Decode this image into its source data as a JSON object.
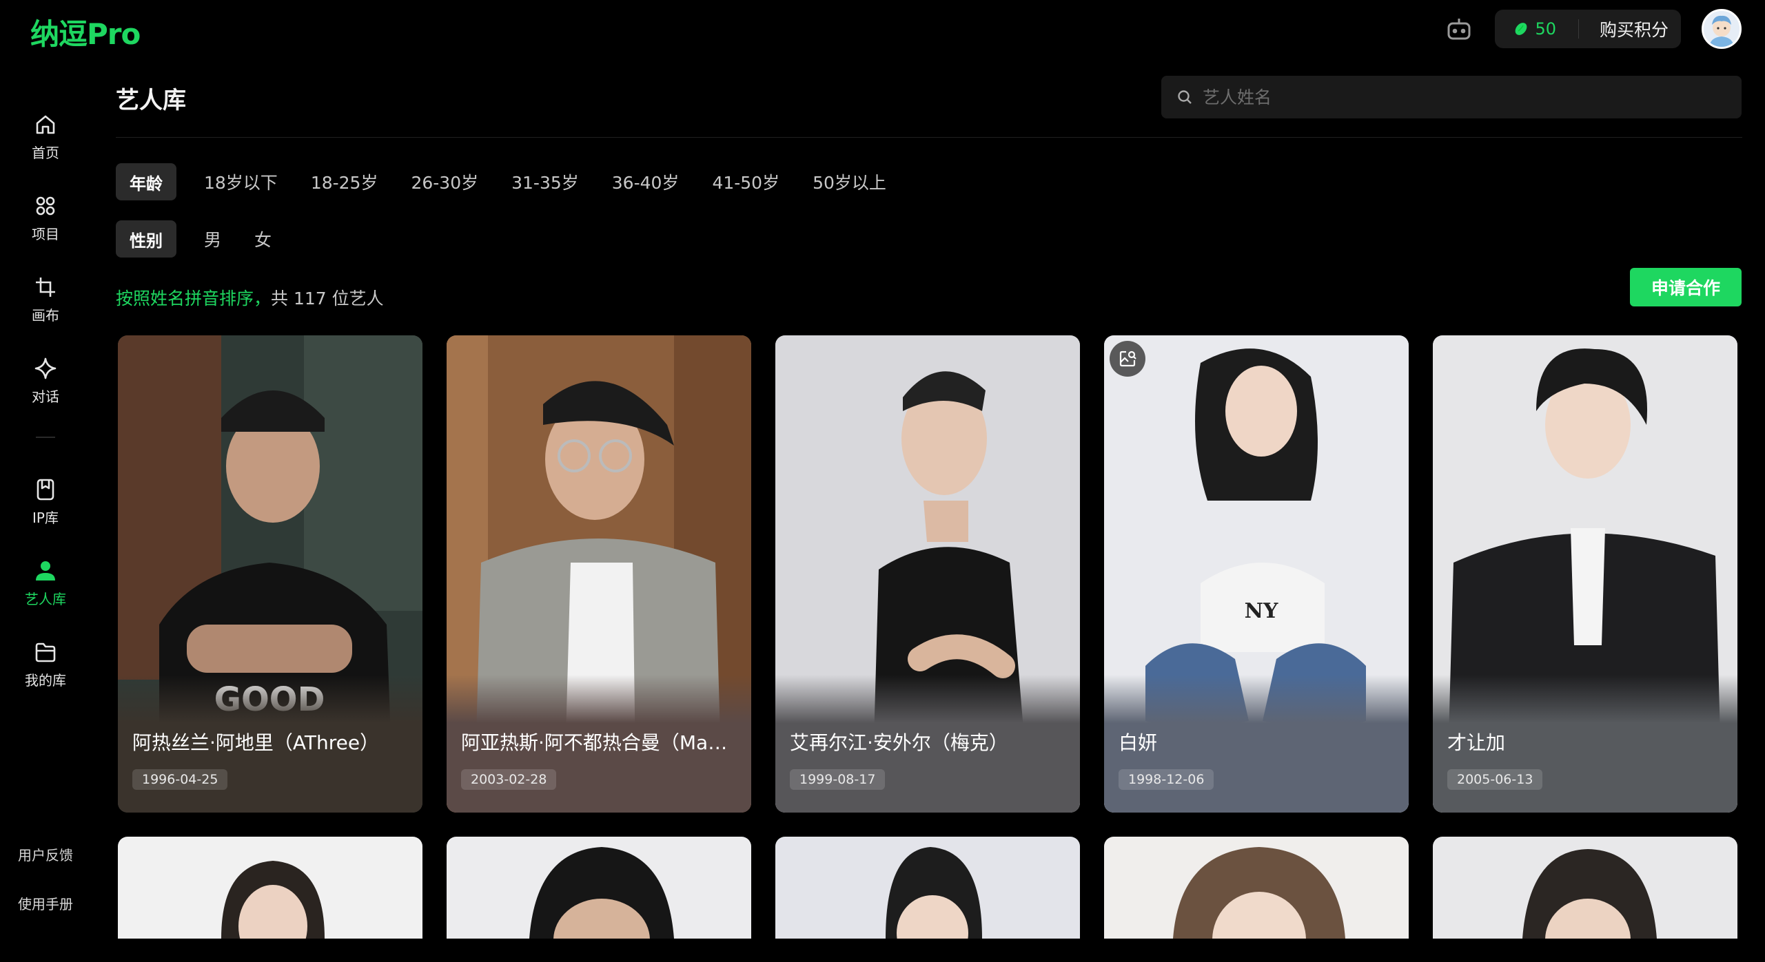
{
  "app": {
    "logo": "纳逗Pro"
  },
  "topbar": {
    "points": "50",
    "buy_label": "购买积分",
    "accent": "#1ed760"
  },
  "sidebar": {
    "items": [
      {
        "label": "首页",
        "icon": "home-icon"
      },
      {
        "label": "项目",
        "icon": "grid-icon"
      },
      {
        "label": "画布",
        "icon": "crop-icon"
      },
      {
        "label": "对话",
        "icon": "sparkle-icon"
      },
      {
        "label": "IP库",
        "icon": "bookmark-icon"
      },
      {
        "label": "艺人库",
        "icon": "person-icon",
        "active": true
      },
      {
        "label": "我的库",
        "icon": "folder-icon"
      }
    ],
    "bottom": {
      "feedback": "用户反馈",
      "manual": "使用手册"
    }
  },
  "page": {
    "title": "艺人库"
  },
  "search": {
    "placeholder": "艺人姓名"
  },
  "filters": {
    "age": {
      "tag": "年龄",
      "options": [
        "18岁以下",
        "18-25岁",
        "26-30岁",
        "31-35岁",
        "36-40岁",
        "41-50岁",
        "50岁以上"
      ]
    },
    "gender": {
      "tag": "性别",
      "options": [
        "男",
        "女"
      ]
    }
  },
  "sort": {
    "label": "按照姓名拼音排序，",
    "count_text": "共 117 位艺人"
  },
  "apply_button": "申请合作",
  "artists": [
    {
      "name": "阿热丝兰·阿地里（AThree）",
      "date": "1996-04-25"
    },
    {
      "name": "阿亚热斯·阿不都热合曼（Mac...",
      "date": "2003-02-28"
    },
    {
      "name": "艾再尔江·安外尔（梅克）",
      "date": "1999-08-17"
    },
    {
      "name": "白妍",
      "date": "1998-12-06"
    },
    {
      "name": "才让加",
      "date": "2005-06-13"
    }
  ]
}
